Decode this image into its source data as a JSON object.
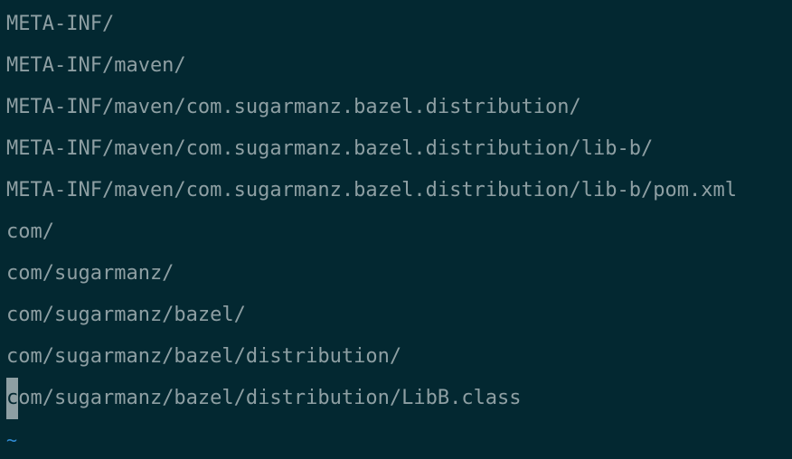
{
  "colors": {
    "background": "#032831",
    "foreground": "#8e9fa3",
    "cursor": "#8e9fa3",
    "tilde": "#2f8ad1"
  },
  "lines": [
    "META-INF/",
    "META-INF/maven/",
    "META-INF/maven/com.sugarmanz.bazel.distribution/",
    "META-INF/maven/com.sugarmanz.bazel.distribution/lib-b/",
    "META-INF/maven/com.sugarmanz.bazel.distribution/lib-b/pom.xml",
    "com/",
    "com/sugarmanz/",
    "com/sugarmanz/bazel/",
    "com/sugarmanz/bazel/distribution/"
  ],
  "cursor_line": {
    "cursor_char": "c",
    "rest": "om/sugarmanz/bazel/distribution/LibB.class"
  },
  "empty_line_marker": "~"
}
